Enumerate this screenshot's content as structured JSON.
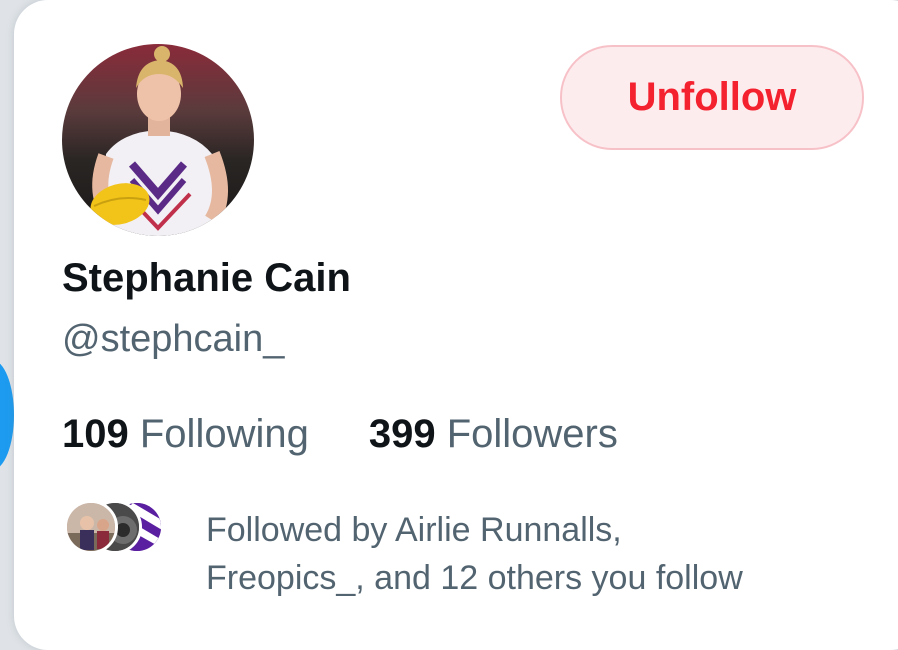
{
  "profile": {
    "display_name": "Stephanie Cain",
    "handle": "@stephcain_",
    "avatar_icon": "profile-photo"
  },
  "actions": {
    "unfollow_label": "Unfollow",
    "unfollow_color": "#f4212e"
  },
  "stats": {
    "following_count": "109",
    "following_label": "Following",
    "followers_count": "399",
    "followers_label": "Followers"
  },
  "followed_by": {
    "line1": "Followed by Airlie Runnalls,",
    "line2": "Freopics_, and 12 others you follow"
  },
  "colors": {
    "accent_blue": "#1d9bf0",
    "secondary_text": "#536471",
    "primary_text": "#0f1419"
  }
}
